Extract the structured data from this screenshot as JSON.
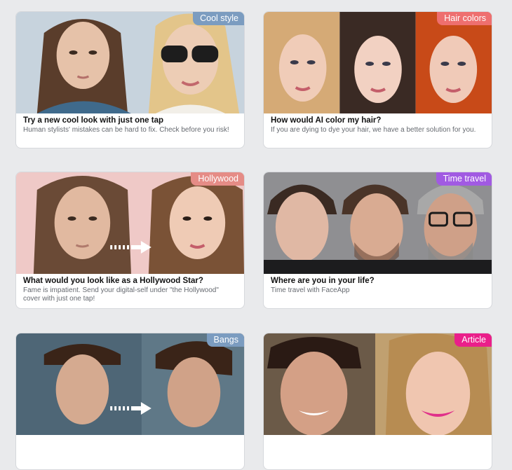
{
  "cards": [
    {
      "badge": "Cool style",
      "badge_color": "#7b9cc0",
      "title": "Try a new cool look with just one tap",
      "description": "Human stylists' mistakes can be hard to fix. Check before you risk!"
    },
    {
      "badge": "Hair colors",
      "badge_color": "#ee6f6f",
      "title": "How would AI color my hair?",
      "description": "If you are dying to dye your hair, we have a better solution for you."
    },
    {
      "badge": "Hollywood",
      "badge_color": "#e58c86",
      "title": "What would you look like as a Hollywood Star?",
      "description": "Fame is impatient. Send your digital-self under \"the Hollywood\" cover with just one tap!"
    },
    {
      "badge": "Time travel",
      "badge_color": "#a15ae2",
      "title": "Where are you in your life?",
      "description": "Time travel with FaceApp"
    },
    {
      "badge": "Bangs",
      "badge_color": "#7b9cc0",
      "title": "",
      "description": ""
    },
    {
      "badge": "Article",
      "badge_color": "#ea1f8a",
      "title": "",
      "description": ""
    }
  ]
}
